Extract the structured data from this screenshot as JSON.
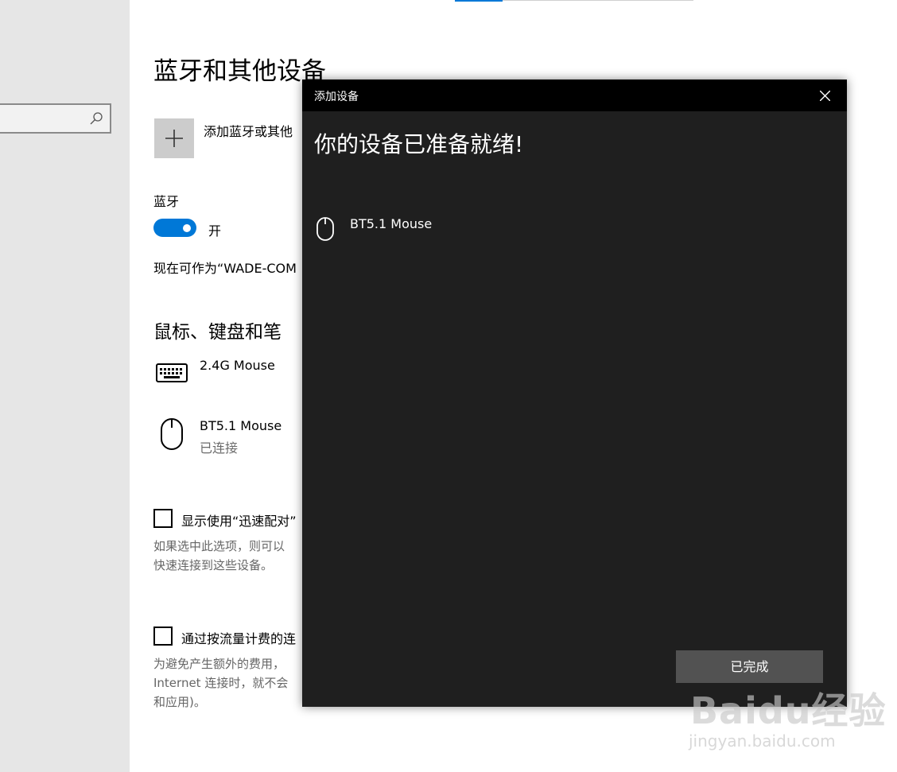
{
  "window": {
    "page_title": "蓝牙和其他设备",
    "add_device_label": "添加蓝牙或其他",
    "bluetooth": {
      "heading": "蓝牙",
      "toggle_state": "开",
      "discoverable_text": "现在可作为“WADE-COM"
    },
    "section_heading": "鼠标、键盘和笔",
    "devices": [
      {
        "name": "2.4G Mouse",
        "status": "",
        "icon": "keyboard-icon"
      },
      {
        "name": "BT5.1 Mouse",
        "status": "已连接",
        "icon": "mouse-icon"
      }
    ],
    "options": [
      {
        "label": "显示使用“迅速配对”",
        "desc_lines": [
          "如果选中此选项，则可以",
          "快速连接到这些设备。"
        ],
        "checked": false
      },
      {
        "label": "通过按流量计费的连",
        "desc_lines": [
          "为避免产生额外的费用，",
          "Internet 连接时，就不会",
          "和应用)。"
        ],
        "checked": false
      }
    ],
    "accent_color": "#0078d7"
  },
  "dialog": {
    "title": "添加设备",
    "heading": "你的设备已准备就绪!",
    "device_name": "BT5.1 Mouse",
    "done_button": "已完成"
  },
  "watermark": {
    "logo": "Baidu经验",
    "url": "jingyan.baidu.com"
  }
}
